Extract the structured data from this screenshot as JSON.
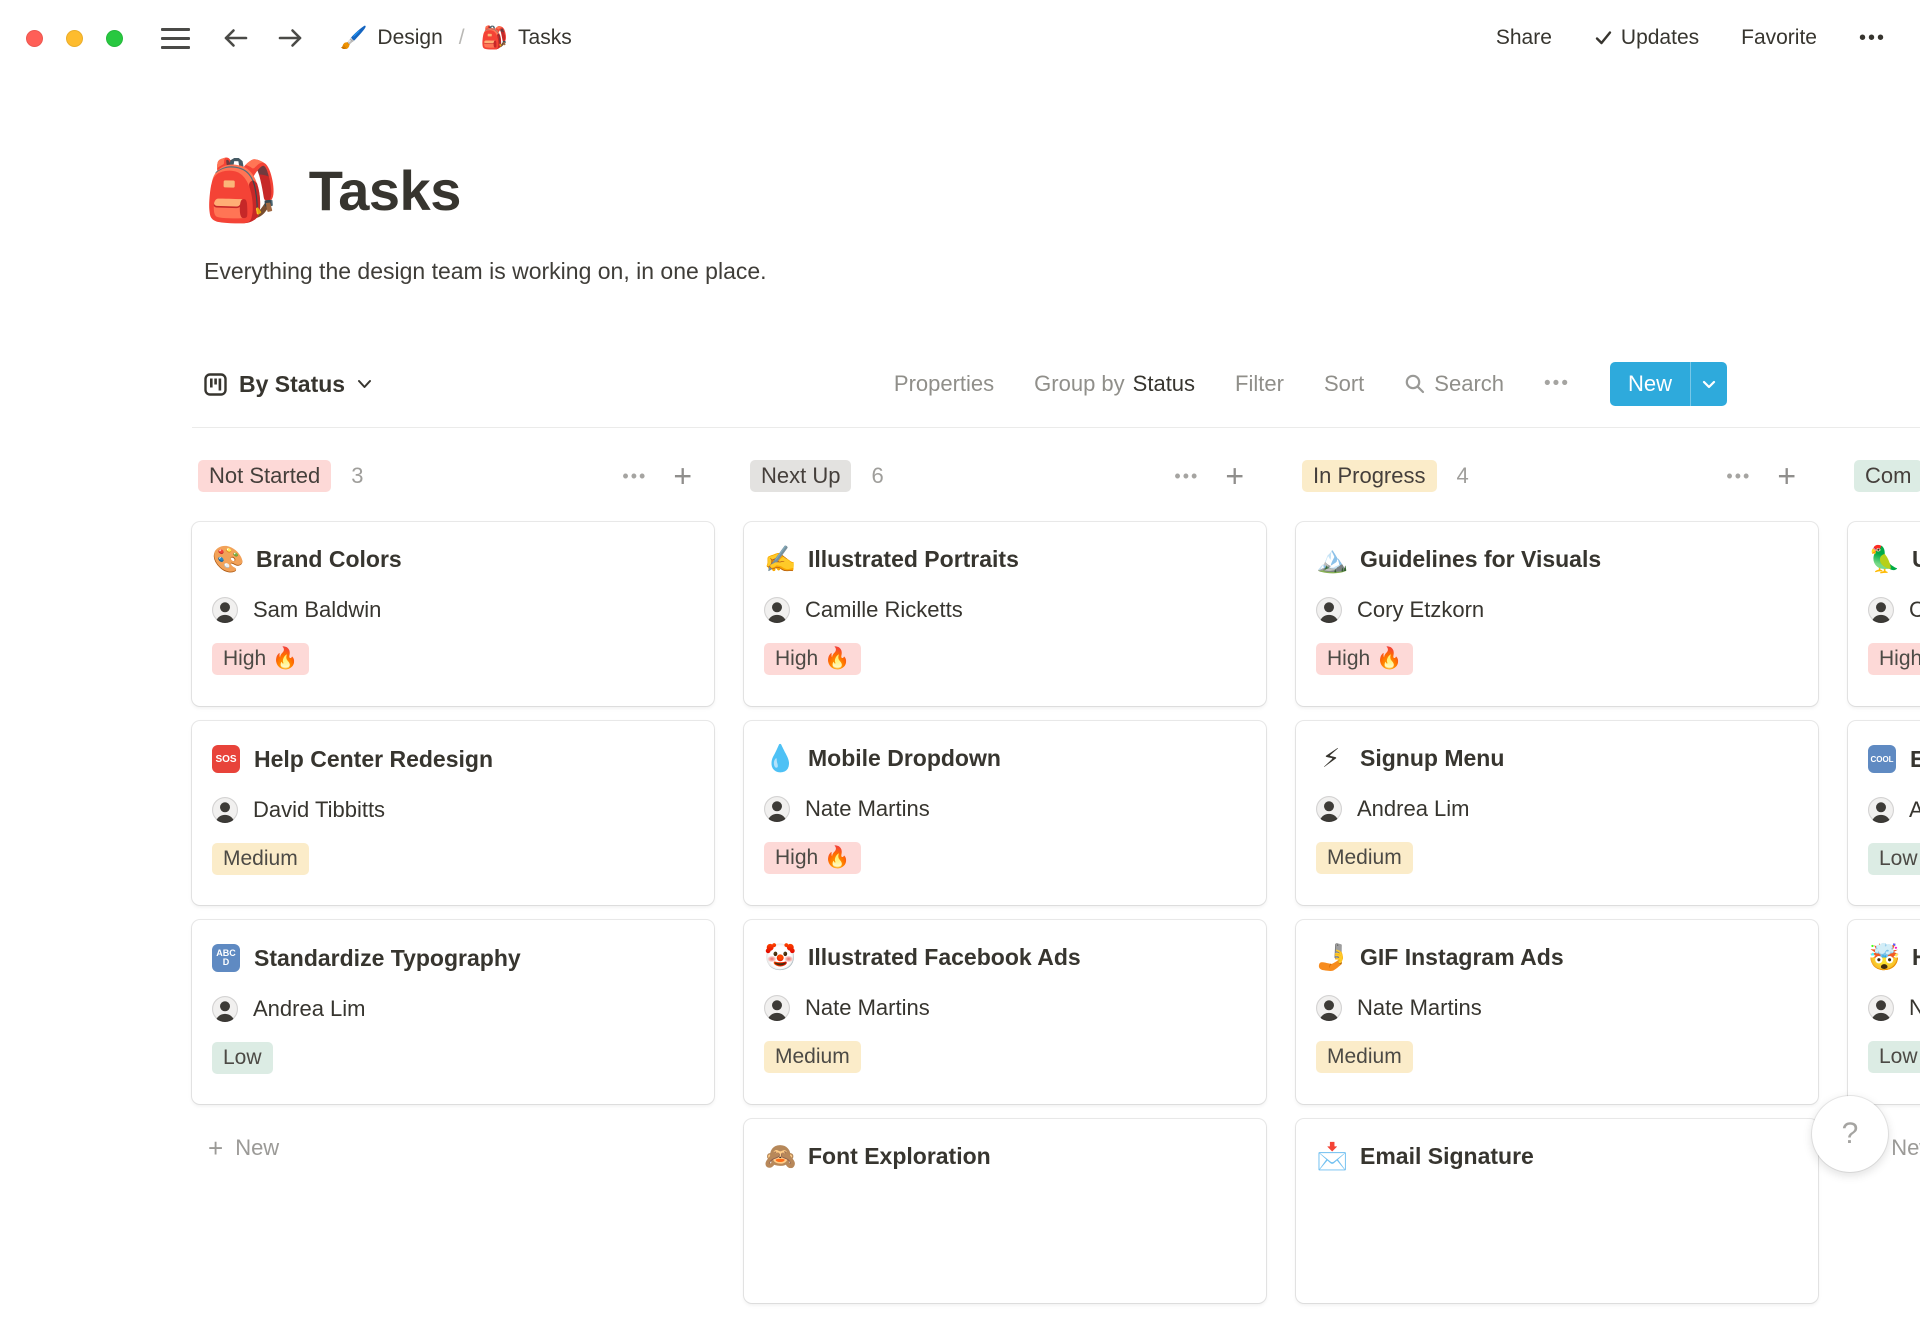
{
  "topbar": {
    "breadcrumb": {
      "parent_icon": "🖌️",
      "parent": "Design",
      "separator": "/",
      "current_icon": "🎒",
      "current": "Tasks"
    },
    "share": "Share",
    "updates": "Updates",
    "favorite": "Favorite"
  },
  "page": {
    "icon": "🎒",
    "title": "Tasks",
    "subtitle": "Everything the design team is working on, in one place."
  },
  "toolbar": {
    "view_label": "By Status",
    "properties": "Properties",
    "group_by_label": "Group by",
    "group_by_value": "Status",
    "filter": "Filter",
    "sort": "Sort",
    "search": "Search",
    "new_label": "New"
  },
  "board": {
    "columns": [
      {
        "name": "Not Started",
        "count": "3",
        "cards": [
          {
            "icon": "🎨",
            "title": "Brand Colors",
            "assignee": "Sam Baldwin",
            "priority": "High 🔥"
          },
          {
            "icon": "SOS",
            "title": "Help Center Redesign",
            "assignee": "David Tibbitts",
            "priority": "Medium"
          },
          {
            "icon": "ABCD",
            "title": "Standardize Typography",
            "assignee": "Andrea Lim",
            "priority": "Low"
          }
        ],
        "new_label": "New"
      },
      {
        "name": "Next Up",
        "count": "6",
        "cards": [
          {
            "icon": "✍️",
            "title": "Illustrated Portraits",
            "assignee": "Camille Ricketts",
            "priority": "High 🔥"
          },
          {
            "icon": "💧",
            "title": "Mobile Dropdown",
            "assignee": "Nate Martins",
            "priority": "High 🔥"
          },
          {
            "icon": "🤡",
            "title": "Illustrated Facebook Ads",
            "assignee": "Nate Martins",
            "priority": "Medium"
          },
          {
            "icon": "🙈",
            "title": "Font Exploration"
          }
        ]
      },
      {
        "name": "In Progress",
        "count": "4",
        "cards": [
          {
            "icon": "🏔️",
            "title": "Guidelines for Visuals",
            "assignee": "Cory Etzkorn",
            "priority": "High 🔥"
          },
          {
            "icon": "⚡",
            "title": "Signup Menu",
            "assignee": "Andrea Lim",
            "priority": "Medium"
          },
          {
            "icon": "🤳",
            "title": "GIF Instagram Ads",
            "assignee": "Nate Martins",
            "priority": "Medium"
          },
          {
            "icon": "📩",
            "title": "Email Signature"
          }
        ]
      },
      {
        "name": "Com",
        "cards": [
          {
            "icon": "🦜",
            "title": "U",
            "assignee": "C",
            "priority": "High 🔥"
          },
          {
            "icon": "COOL",
            "title": "E",
            "assignee": "A",
            "priority": "Low"
          },
          {
            "icon": "🤯",
            "title": "H",
            "assignee": "N",
            "priority": "Low"
          }
        ],
        "new_label": "New"
      }
    ]
  },
  "icons": {
    "dots": "•••",
    "plus": "+",
    "help": "?"
  },
  "colors": {
    "accent_blue": "#2eaadc",
    "badge_pink": "#fdd9d7",
    "badge_gray": "#e3e2e0",
    "badge_yellow": "#fbecc9",
    "badge_green": "#dcece4",
    "traffic_red": "#ff5f57",
    "traffic_yellow": "#febc2e",
    "traffic_green": "#28c840"
  }
}
